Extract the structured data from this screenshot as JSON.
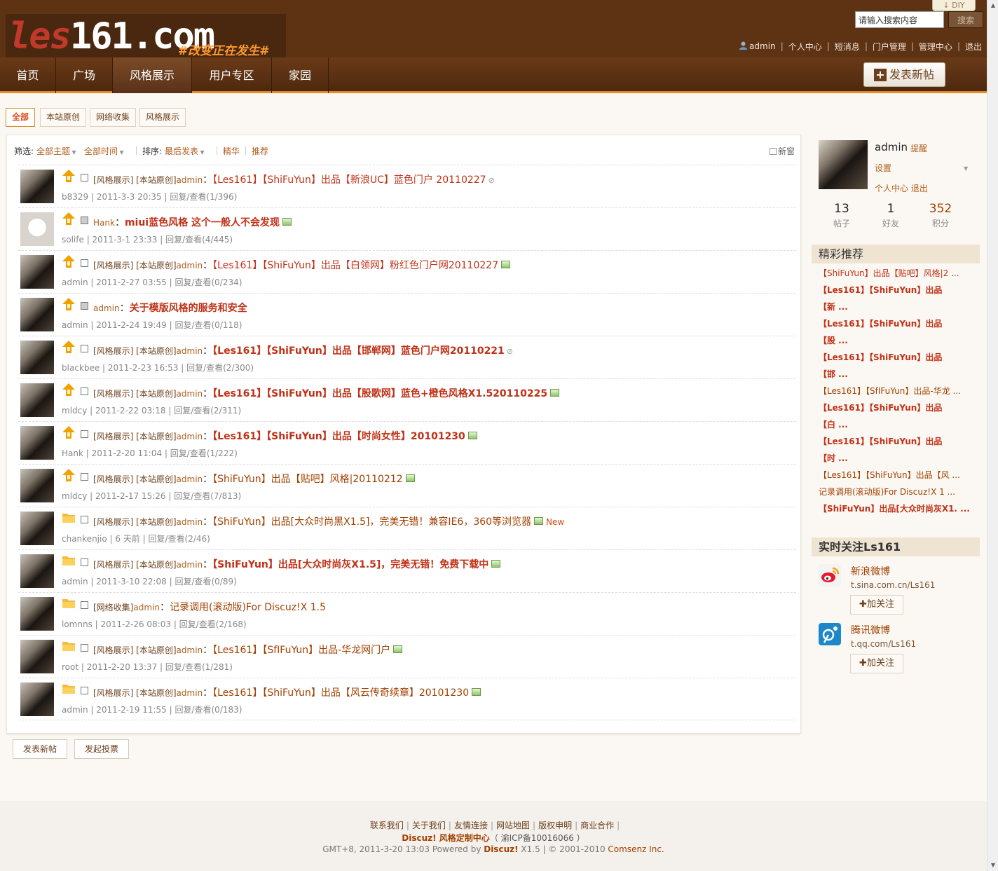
{
  "header": {
    "logo_main_1": "les",
    "logo_main_2": "161.com",
    "logo_slogan": "#改变正在发生#",
    "search_placeholder": "请输入搜索内容",
    "search_value": "请输入搜索内容",
    "search_button": "搜索",
    "diy_label": "DIY",
    "user_links": [
      "admin",
      "个人中心",
      "短消息",
      "门户管理",
      "管理中心",
      "退出"
    ]
  },
  "nav": {
    "items": [
      "首页",
      "广场",
      "风格展示",
      "用户专区",
      "家园"
    ],
    "active": "风格展示",
    "new_post_label": "发表新帖"
  },
  "filter_tabs": [
    "全部",
    "本站原创",
    "网络收集",
    "风格展示"
  ],
  "filter_bar": {
    "filter_label": "筛选:",
    "all_topics": "全部主题",
    "all_time": "全部时间",
    "sort_label": "排序:",
    "sort_value": "最后发表",
    "digest": "精华",
    "recommend": "推荐",
    "new_window": "新窗"
  },
  "threads": [
    {
      "cat": "[风格展示] [本站原创]",
      "author": "admin",
      "title": "【Les161】【ShiFuYun】出品【新浪UC】蓝色门户 20110227",
      "meta_user": "b8329",
      "meta_rest": " | 2011-3-3 20:35 |  回复/查看(1/396)"
    },
    {
      "cat": "",
      "author": "Hank",
      "title": "miui蓝色风格 这个一般人不会发现",
      "meta_user": "solife",
      "meta_rest": " | 2011-3-1 23:33 |  回复/查看(4/445)"
    },
    {
      "cat": "[风格展示] [本站原创]",
      "author": "admin",
      "title": "【Les161】【ShiFuYun】出品【白领网】粉红色门户网20110227",
      "meta_user": "admin",
      "meta_rest": " | 2011-2-27 03:55 |  回复/查看(0/234)"
    },
    {
      "cat": "",
      "author": "admin",
      "title": "关于模版风格的服务和安全",
      "meta_user": "admin",
      "meta_rest": " | 2011-2-24 19:49 |  回复/查看(0/118)"
    },
    {
      "cat": "[风格展示] [本站原创]",
      "author": "admin",
      "title": "【Les161】【ShiFuYun】出品【邯郸网】蓝色门户网20110221",
      "meta_user": "blackbee",
      "meta_rest": " | 2011-2-23 16:53 |  回复/查看(2/300)"
    },
    {
      "cat": "[风格展示] [本站原创]",
      "author": "admin",
      "title": "【Les161】【ShiFuYun】出品【股歌网】蓝色+橙色风格X1.520110225",
      "meta_user": "mldcy",
      "meta_rest": " | 2011-2-22 03:18 |  回复/查看(2/311)"
    },
    {
      "cat": "[风格展示] [本站原创]",
      "author": "admin",
      "title": "【Les161】【ShiFuYun】出品【时尚女性】20101230",
      "meta_user": "Hank",
      "meta_rest": " | 2011-2-20 11:04 |  回复/查看(1/222)"
    },
    {
      "cat": "[风格展示] [本站原创]",
      "author": "admin",
      "title": "【ShiFuYun】出品【贴吧】风格|20110212",
      "meta_user": "mldcy",
      "meta_rest": " | 2011-2-17 15:26 |  回复/查看(7/813)"
    },
    {
      "cat": "[风格展示] [本站原创]",
      "author": "admin",
      "title": "【ShiFuYun】出品[大众时尚黑X1.5]，完美无错！兼容IE6，360等浏览器",
      "new": "New",
      "meta_user": "chankenjio",
      "meta_rest": " | 6 天前 |  回复/查看(2/46)"
    },
    {
      "cat": "[风格展示] [本站原创]",
      "author": "admin",
      "title": "【ShiFuYun】出品[大众时尚灰X1.5]，完美无错！免费下载中",
      "meta_user": "admin",
      "meta_rest": " | 2011-3-10 22:08 |  回复/查看(0/89)"
    },
    {
      "cat": "[网络收集]",
      "author": "admin",
      "title": "记录调用(滚动版)For Discuz!X 1.5",
      "meta_user": "lomnns",
      "meta_rest": " | 2011-2-26 08:03 |  回复/查看(2/168)"
    },
    {
      "cat": "[风格展示] [本站原创]",
      "author": "admin",
      "title": "【Les161】【SfIFuYun】出品-华龙网门户",
      "meta_user": "root",
      "meta_rest": " | 2011-2-20 13:37 |  回复/查看(1/281)"
    },
    {
      "cat": "[风格展示] [本站原创]",
      "author": "admin",
      "title": "【Les161】【ShiFuYun】出品【风云传奇续章】20101230",
      "meta_user": "admin",
      "meta_rest": " | 2011-2-19 11:55 |  回复/查看(0/183)"
    }
  ],
  "bottom_buttons": [
    "发表新帖",
    "发起投票"
  ],
  "sidebar": {
    "profile": {
      "name": "admin",
      "remind": "提醒",
      "settings": "设置",
      "links": "个人中心 退出",
      "stats": [
        {
          "value": "13",
          "label": "帖子"
        },
        {
          "value": "1",
          "label": "好友"
        },
        {
          "value": "352",
          "label": "积分"
        }
      ]
    },
    "picks_title": "精彩推荐",
    "picks": [
      "【ShiFuYun】出品【贴吧】风格|2 ...",
      "【Les161】【ShiFuYun】出品",
      "【新 ...",
      "【Les161】【ShiFuYun】出品",
      "【股 ...",
      "【Les161】【ShiFuYun】出品",
      "【邯 ...",
      "【Les161】【SfIFuYun】出品-华龙 ...",
      "【Les161】【ShiFuYun】出品",
      "【白 ...",
      "【Les161】【ShiFuYun】出品",
      "【时 ...",
      "【Les161】【ShiFuYun】出品【风 ...",
      "记录调用(滚动版)For Discuz!X 1 ...",
      "【ShiFuYun】出品[大众时尚灰X1. ..."
    ],
    "follow_title": "实时关注Ls161",
    "follows": [
      {
        "name": "新浪微博",
        "url": "t.sina.com.cn/Ls161",
        "button": "加关注"
      },
      {
        "name": "腾讯微博",
        "url": "t.qq.com/Ls161",
        "button": "加关注"
      }
    ]
  },
  "footer": {
    "links": [
      "联系我们",
      "关于我们",
      "友情连接",
      "网站地图",
      "版权申明",
      "商业合作"
    ],
    "line2_brand": "Discuz! 风格定制中心",
    "line2_icp": "（ 渝ICP备10016066 ）",
    "line3_prefix": "GMT+8, 2011-3-20 13:03 Powered by ",
    "line3_brand": "Discuz!",
    "line3_version": " X1.5 | © 2001-2010 ",
    "line3_company": "Comsenz Inc."
  }
}
